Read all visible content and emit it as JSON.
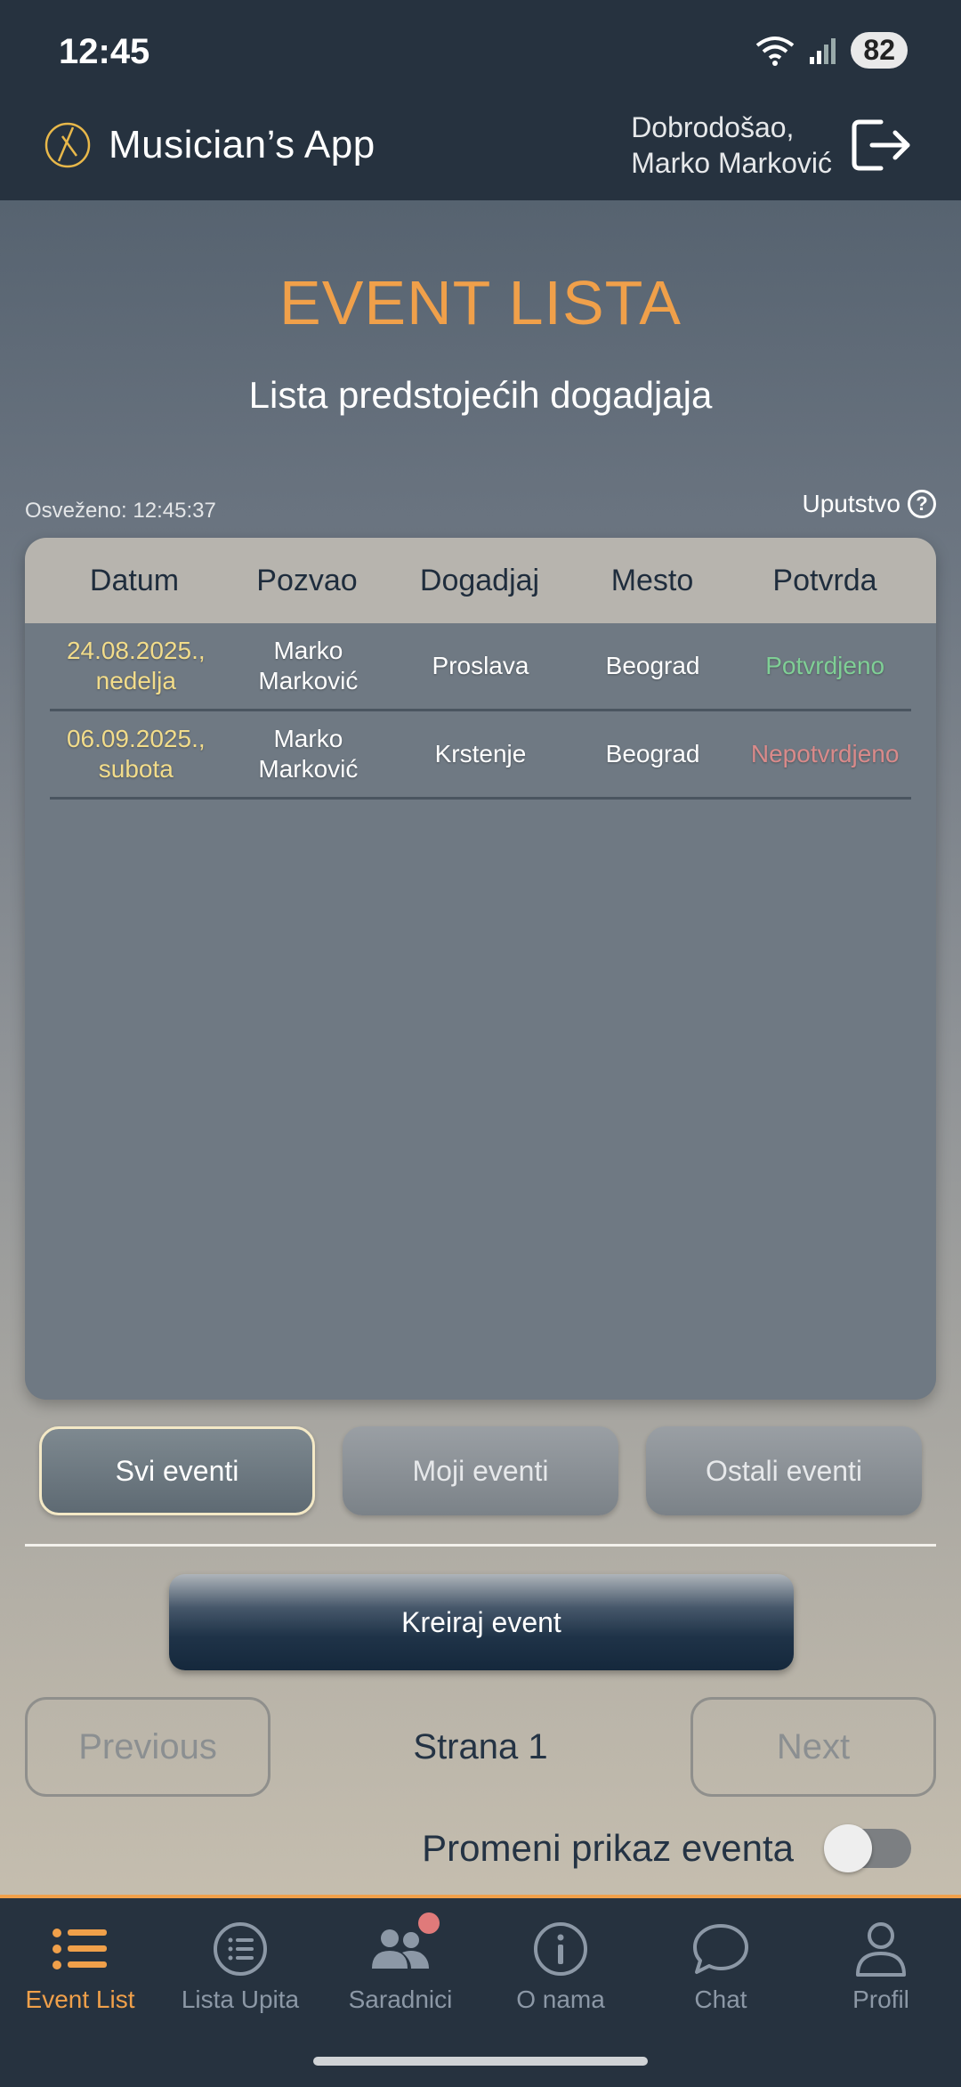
{
  "status": {
    "time": "12:45",
    "battery": "82"
  },
  "header": {
    "app_title": "Musician’s App",
    "welcome_line1": "Dobrodošao,",
    "welcome_line2": "Marko Marković"
  },
  "page": {
    "title": "EVENT LISTA",
    "subtitle": "Lista predstojećih dogadjaja",
    "refreshed": "Osveženo: 12:45:37",
    "help_label": "Uputstvo"
  },
  "table": {
    "headers": [
      "Datum",
      "Pozvao",
      "Dogadjaj",
      "Mesto",
      "Potvrda"
    ],
    "rows": [
      {
        "date_line1": "24.08.2025.,",
        "date_line2": "nedelja",
        "by_line1": "Marko",
        "by_line2": "Marković",
        "event": "Proslava",
        "place": "Beograd",
        "status": "Potvrdjeno"
      },
      {
        "date_line1": "06.09.2025.,",
        "date_line2": "subota",
        "by_line1": "Marko",
        "by_line2": "Marković",
        "event": "Krstenje",
        "place": "Beograd",
        "status": "Nepotvrdjeno"
      }
    ]
  },
  "filters": {
    "all": "Svi eventi",
    "mine": "Moji eventi",
    "others": "Ostali eventi",
    "active": "all"
  },
  "create_label": "Kreiraj event",
  "pager": {
    "prev": "Previous",
    "page": "Strana 1",
    "next": "Next"
  },
  "toggle": {
    "label": "Promeni prikaz eventa",
    "on": false
  },
  "nav": [
    {
      "label": "Event List",
      "icon": "list-icon",
      "active": true
    },
    {
      "label": "Lista Upita",
      "icon": "list-circle-icon"
    },
    {
      "label": "Saradnici",
      "icon": "users-icon"
    },
    {
      "label": "O nama",
      "icon": "info-icon"
    },
    {
      "label": "Chat",
      "icon": "chat-icon"
    },
    {
      "label": "Profil",
      "icon": "user-icon"
    }
  ],
  "colors": {
    "accent": "#f0a04a",
    "confirmed": "#7fcf95",
    "unconfirmed": "#d98a8a",
    "header_bg": "#26323f"
  }
}
